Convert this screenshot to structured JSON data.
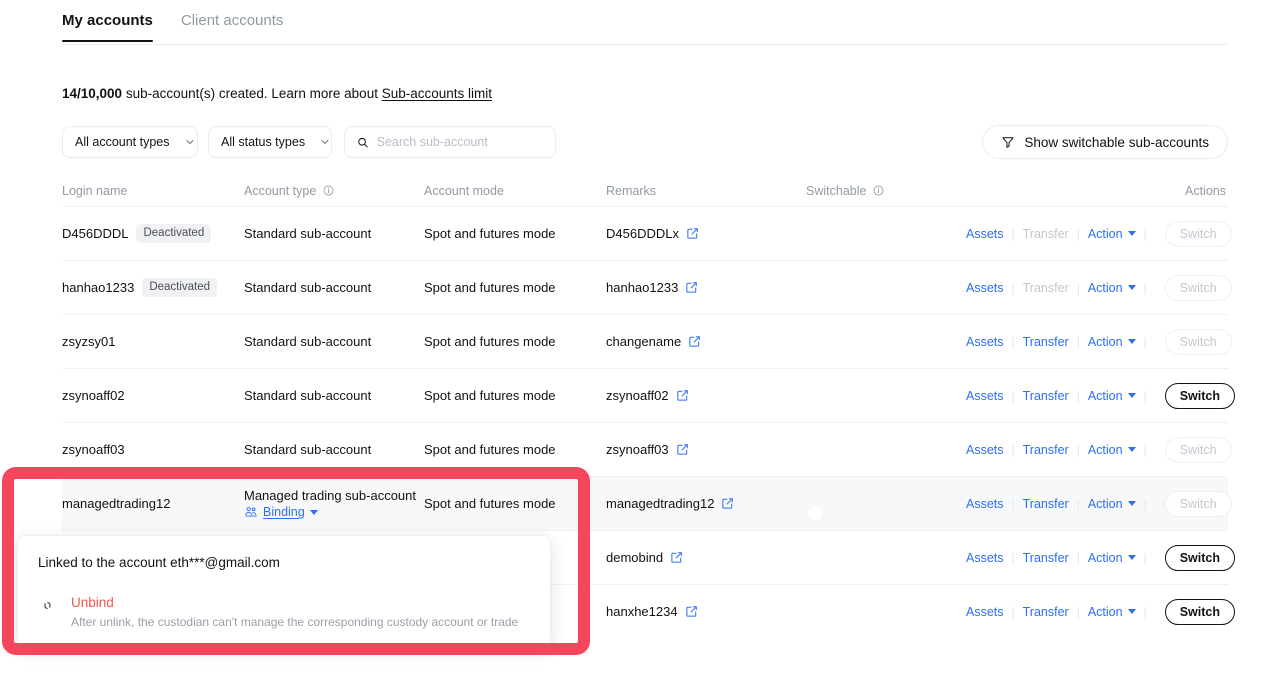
{
  "tabs": [
    {
      "label": "My accounts",
      "active": true
    },
    {
      "label": "Client accounts",
      "active": false
    }
  ],
  "count_line": {
    "count": "14/10,000",
    "text": " sub-account(s) created. Learn more about ",
    "link": "Sub-accounts limit"
  },
  "filters": {
    "account_type": "All account types",
    "status_type": "All status types",
    "search_placeholder": "Search sub-account",
    "search_value": "",
    "show_switchable": "Show switchable sub-accounts"
  },
  "table": {
    "headers": {
      "login_name": "Login name",
      "account_type": "Account type",
      "account_mode": "Account mode",
      "remarks": "Remarks",
      "switchable": "Switchable",
      "actions": "Actions"
    },
    "rows": [
      {
        "login_name": "D456DDDL",
        "status_badge": "Deactivated",
        "account_type": "Standard sub-account",
        "account_mode": "Spot and futures mode",
        "remarks": "D456DDDLx",
        "switchable": "on",
        "assets": "Assets",
        "transfer": "Transfer",
        "transfer_disabled": true,
        "action": "Action",
        "switch": "Switch",
        "switch_enabled": false,
        "highlighted": false
      },
      {
        "login_name": "hanhao1233",
        "status_badge": "Deactivated",
        "account_type": "Standard sub-account",
        "account_mode": "Spot and futures mode",
        "remarks": "hanhao1233",
        "switchable": "on",
        "assets": "Assets",
        "transfer": "Transfer",
        "transfer_disabled": true,
        "action": "Action",
        "switch": "Switch",
        "switch_enabled": false,
        "highlighted": false
      },
      {
        "login_name": "zsyzsy01",
        "status_badge": "",
        "account_type": "Standard sub-account",
        "account_mode": "Spot and futures mode",
        "remarks": "changename",
        "switchable": "off",
        "assets": "Assets",
        "transfer": "Transfer",
        "transfer_disabled": false,
        "action": "Action",
        "switch": "Switch",
        "switch_enabled": false,
        "highlighted": false
      },
      {
        "login_name": "zsynoaff02",
        "status_badge": "",
        "account_type": "Standard sub-account",
        "account_mode": "Spot and futures mode",
        "remarks": "zsynoaff02",
        "switchable": "on",
        "assets": "Assets",
        "transfer": "Transfer",
        "transfer_disabled": false,
        "action": "Action",
        "switch": "Switch",
        "switch_enabled": true,
        "highlighted": false
      },
      {
        "login_name": "zsynoaff03",
        "status_badge": "",
        "account_type": "Standard sub-account",
        "account_mode": "Spot and futures mode",
        "remarks": "zsynoaff03",
        "switchable": "off",
        "assets": "Assets",
        "transfer": "Transfer",
        "transfer_disabled": false,
        "action": "Action",
        "switch": "Switch",
        "switch_enabled": false,
        "highlighted": false
      },
      {
        "login_name": "managedtrading12",
        "status_badge": "",
        "account_type": "Managed trading sub-account",
        "binding_label": "Binding",
        "account_mode": "Spot and futures mode",
        "remarks": "managedtrading12",
        "switchable": "off",
        "assets": "Assets",
        "transfer": "Transfer",
        "transfer_disabled": false,
        "action": "Action",
        "switch": "Switch",
        "switch_enabled": false,
        "highlighted": true
      },
      {
        "login_name": "",
        "status_badge": "",
        "account_type": "",
        "account_mode": "",
        "remarks": "demobind",
        "switchable": "on",
        "assets": "Assets",
        "transfer": "Transfer",
        "transfer_disabled": false,
        "action": "Action",
        "switch": "Switch",
        "switch_enabled": true,
        "highlighted": false
      },
      {
        "login_name": "",
        "status_badge": "",
        "account_type": "",
        "account_mode": "",
        "remarks": "hanxhe1234",
        "switchable": "on",
        "assets": "Assets",
        "transfer": "Transfer",
        "transfer_disabled": false,
        "action": "Action",
        "switch": "Switch",
        "switch_enabled": true,
        "highlighted": false
      }
    ]
  },
  "popup": {
    "linked_text": "Linked to the account eth***@gmail.com",
    "unbind_title": "Unbind",
    "unbind_desc": "After unlink, the custodian can't manage the corresponding custody account or trade"
  },
  "colors": {
    "accent_blue": "#2e6ef2",
    "highlight_red": "#f6465d",
    "unbind_red": "#f0564d",
    "muted": "#929aa5"
  }
}
